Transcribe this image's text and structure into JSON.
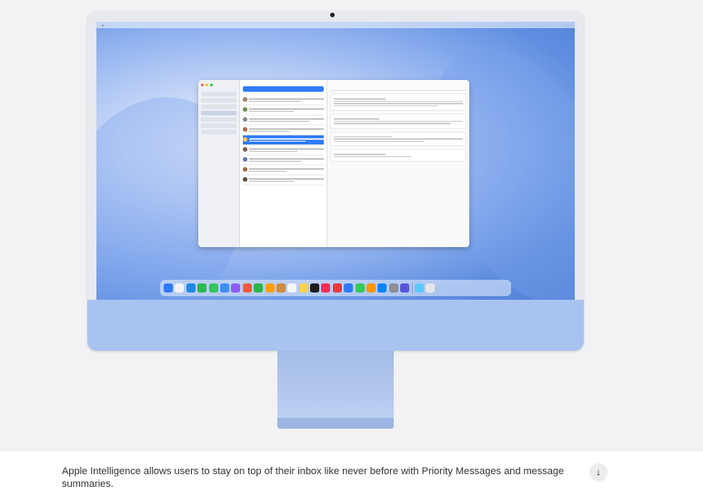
{
  "caption": "Apple Intelligence allows users to stay on top of their inbox like never before with Priority Messages and message summaries.",
  "scroll_button": {
    "icon": "arrow-down-icon",
    "glyph": "↓"
  },
  "device": {
    "body_color": "#e7e9ee",
    "chin_color": "#a9c3f0",
    "stand_color": "#a3bbe6"
  },
  "dock_colors": [
    "#3478f6",
    "#f2f2f2",
    "#1e88e5",
    "#2fb84f",
    "#34c759",
    "#3f8cf3",
    "#8e5cf5",
    "#fa5a3c",
    "#2db34a",
    "#ff9f0a",
    "#d28b3c",
    "#f5f5f5",
    "#fdd24a",
    "#1c1c1e",
    "#ff2d55",
    "#e83a3a",
    "#2f7cf6",
    "#34c759",
    "#ff9500",
    "#0a84ff",
    "#8e8e93",
    "#5856d6"
  ],
  "dock_trail_colors": [
    "#5ac8fa",
    "#e5e5ea"
  ]
}
